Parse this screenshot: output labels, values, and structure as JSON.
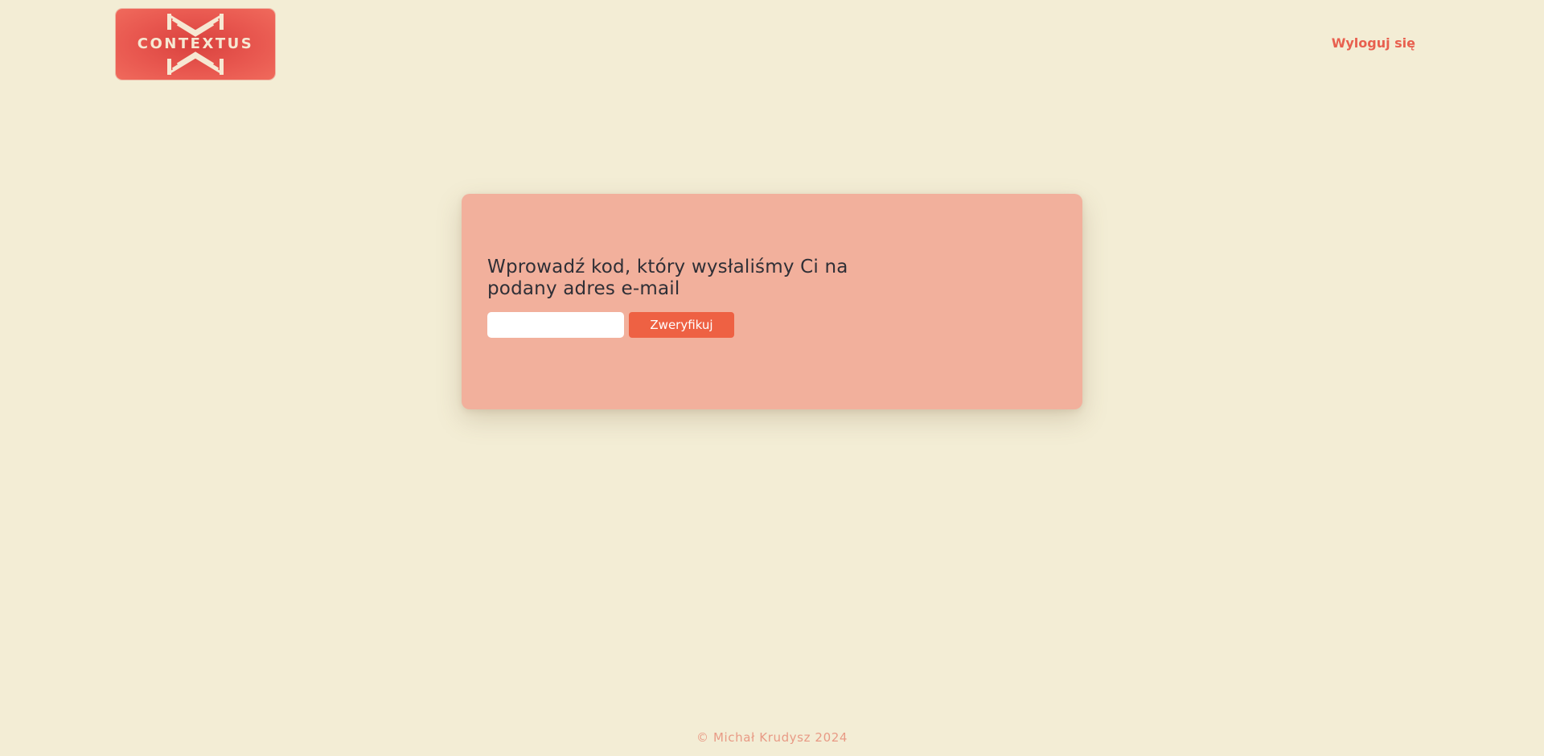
{
  "header": {
    "logo_text": "CONTEXTUS",
    "logout_label": "Wyloguj się"
  },
  "verify_card": {
    "title": "Wprowadź kod, który wysłaliśmy Ci na podany adres e-mail",
    "code_input": {
      "value": "",
      "placeholder": ""
    },
    "verify_label": "Zweryfikuj"
  },
  "footer": {
    "copyright": "© Michał Krudysz 2024"
  },
  "colors": {
    "background": "#f3edd5",
    "card": "#f2b09c",
    "accent": "#ee6143",
    "logo": "#e8574f",
    "link": "#e8604f",
    "footer_text": "#e89a85"
  },
  "icons": {
    "logo_mark": "contextus-logo-icon"
  }
}
